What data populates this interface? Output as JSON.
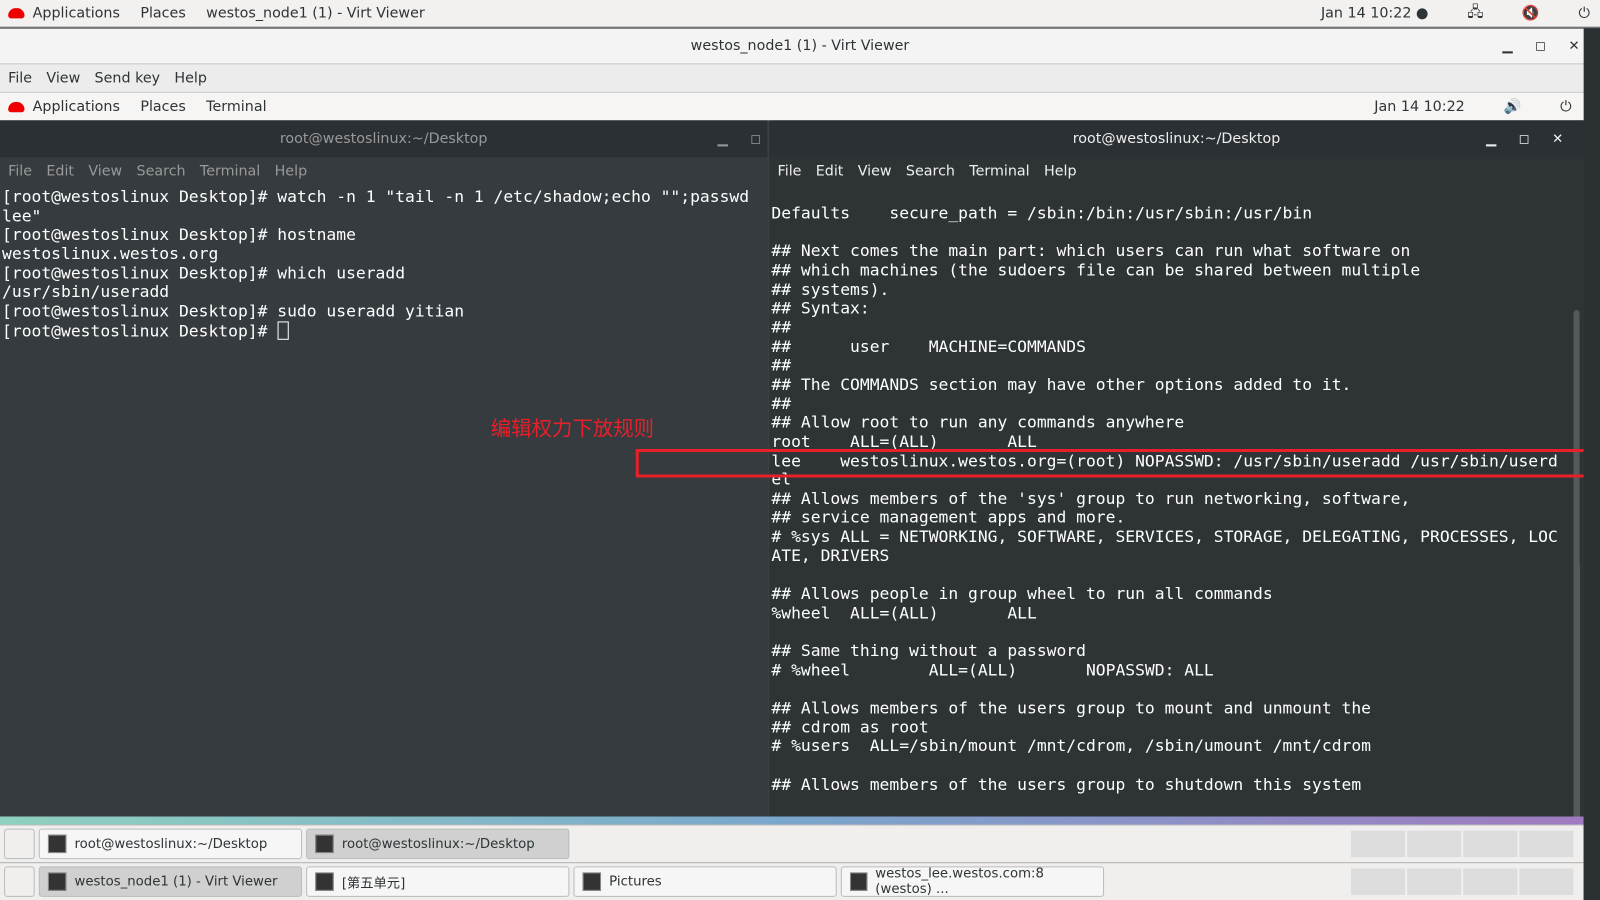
{
  "host_topbar": {
    "applications": "Applications",
    "places": "Places",
    "active_window": "westos_node1 (1) - Virt Viewer",
    "clock": "Jan 14  10:22 ●"
  },
  "viewer": {
    "title": "westos_node1 (1) - Virt Viewer",
    "menu": [
      "File",
      "View",
      "Send key",
      "Help"
    ]
  },
  "guest_topbar": {
    "applications": "Applications",
    "places": "Places",
    "app": "Terminal",
    "clock": "Jan 14  10:22"
  },
  "terminal_left": {
    "title": "root@westoslinux:~/Desktop",
    "menu": [
      "File",
      "Edit",
      "View",
      "Search",
      "Terminal",
      "Help"
    ],
    "lines": [
      "[root@westoslinux Desktop]# watch -n 1 \"tail -n 1 /etc/shadow;echo \"\";passwd",
      "lee\"",
      "[root@westoslinux Desktop]# hostname",
      "westoslinux.westos.org",
      "[root@westoslinux Desktop]# which useradd",
      "/usr/sbin/useradd",
      "[root@westoslinux Desktop]# sudo useradd yitian"
    ],
    "prompt": "[root@westoslinux Desktop]# "
  },
  "terminal_right": {
    "title": "root@westoslinux:~/Desktop",
    "menu": [
      "File",
      "Edit",
      "View",
      "Search",
      "Terminal",
      "Help"
    ],
    "lines": [
      "Defaults    secure_path = /sbin:/bin:/usr/sbin:/usr/bin",
      "",
      "## Next comes the main part: which users can run what software on",
      "## which machines (the sudoers file can be shared between multiple",
      "## systems).",
      "## Syntax:",
      "##",
      "##      user    MACHINE=COMMANDS",
      "##",
      "## The COMMANDS section may have other options added to it.",
      "##",
      "## Allow root to run any commands anywhere",
      "root    ALL=(ALL)       ALL",
      "lee    westoslinux.westos.org=(root) NOPASSWD: /usr/sbin/useradd /usr/sbin/userd",
      "el",
      "## Allows members of the 'sys' group to run networking, software,",
      "## service management apps and more.",
      "# %sys ALL = NETWORKING, SOFTWARE, SERVICES, STORAGE, DELEGATING, PROCESSES, LOC",
      "ATE, DRIVERS",
      "",
      "## Allows people in group wheel to run all commands",
      "%wheel  ALL=(ALL)       ALL",
      "",
      "## Same thing without a password",
      "# %wheel        ALL=(ALL)       NOPASSWD: ALL",
      "",
      "## Allows members of the users group to mount and unmount the",
      "## cdrom as root",
      "# %users  ALL=/sbin/mount /mnt/cdrom, /sbin/umount /mnt/cdrom",
      "",
      "## Allows members of the users group to shutdown this system"
    ]
  },
  "annotation": {
    "text": "编辑权力下放规则",
    "color": "#e8202a"
  },
  "guest_taskbar": [
    "root@westoslinux:~/Desktop",
    "root@westoslinux:~/Desktop"
  ],
  "host_taskbar": [
    "westos_node1 (1) - Virt Viewer",
    "[第五单元]",
    "Pictures",
    "westos_lee.westos.com:8 (westos) ..."
  ]
}
